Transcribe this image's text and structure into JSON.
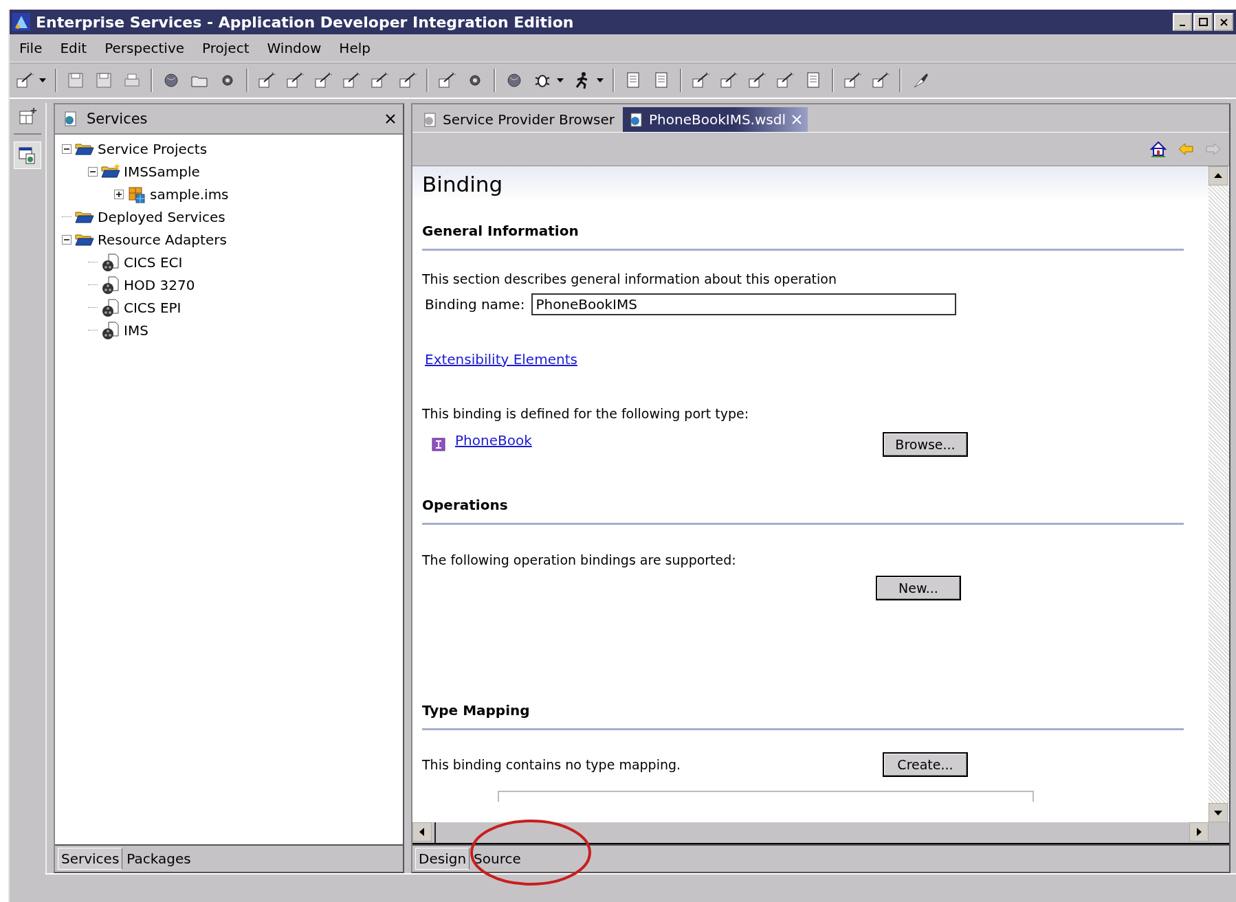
{
  "window": {
    "title": "Enterprise Services - Application Developer Integration Edition"
  },
  "menu": [
    "File",
    "Edit",
    "Perspective",
    "Project",
    "Window",
    "Help"
  ],
  "services_view": {
    "title": "Services",
    "tree": [
      {
        "label": "Service Projects",
        "kind": "folder",
        "expanded": true,
        "children": [
          {
            "label": "IMSSample",
            "kind": "project",
            "expanded": true,
            "children": [
              {
                "label": "sample.ims",
                "kind": "file",
                "expanded": false
              }
            ]
          }
        ]
      },
      {
        "label": "Deployed Services",
        "kind": "folder"
      },
      {
        "label": "Resource Adapters",
        "kind": "folder",
        "expanded": true,
        "children": [
          {
            "label": "CICS ECI",
            "kind": "adapter"
          },
          {
            "label": "HOD 3270",
            "kind": "adapter"
          },
          {
            "label": "CICS EPI",
            "kind": "adapter"
          },
          {
            "label": "IMS",
            "kind": "adapter"
          }
        ]
      }
    ],
    "bottom_tabs": [
      {
        "label": "Services",
        "selected": true
      },
      {
        "label": "Packages",
        "selected": false
      }
    ]
  },
  "editor": {
    "tabs": [
      {
        "label": "Service Provider Browser",
        "selected": false
      },
      {
        "label": "PhoneBookIMS.wsdl",
        "selected": true
      }
    ],
    "heading": "Binding",
    "general": {
      "title": "General Information",
      "description": "This section describes general information about this operation",
      "binding_label": "Binding name:",
      "binding_value": "PhoneBookIMS",
      "link": "Extensibility Elements",
      "port_text": "This binding is defined for the following port type:",
      "port_type": "PhoneBook",
      "browse": "Browse..."
    },
    "operations": {
      "title": "Operations",
      "text": "The following operation bindings are supported:",
      "button": "New..."
    },
    "type_mapping": {
      "title": "Type Mapping",
      "text": "This binding contains no type mapping.",
      "button": "Create..."
    },
    "bottom_tabs": [
      {
        "label": "Design",
        "selected": true
      },
      {
        "label": "Source",
        "selected": false
      }
    ]
  }
}
